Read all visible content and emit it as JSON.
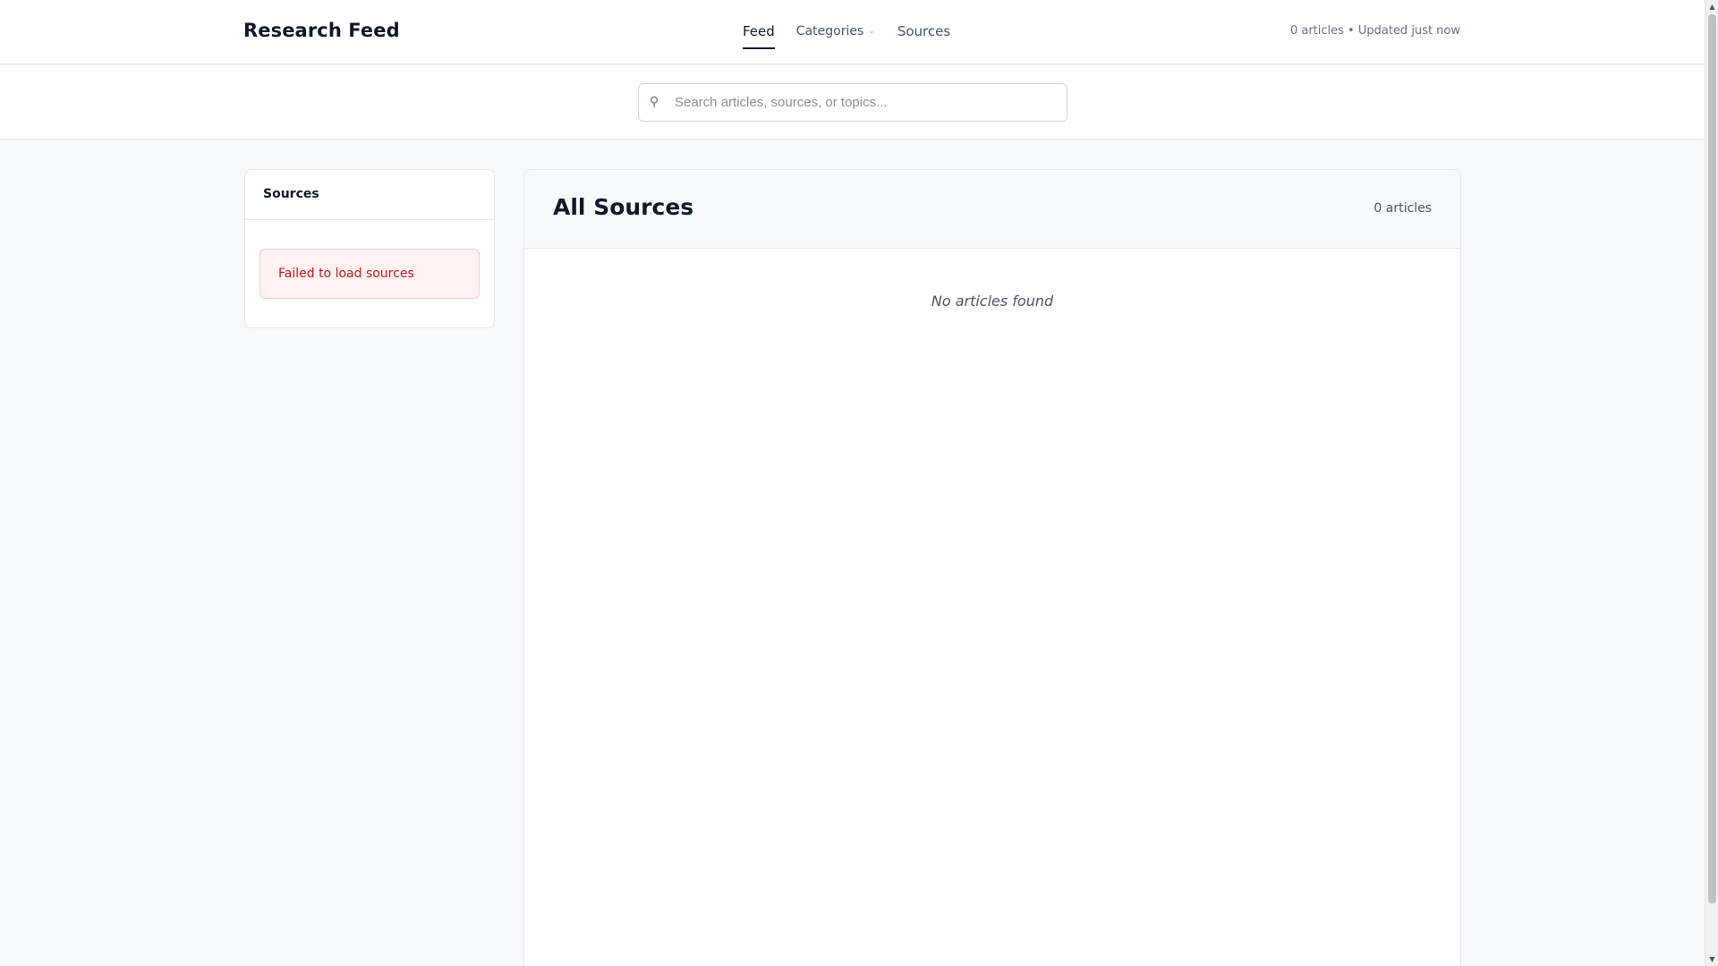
{
  "header": {
    "brand": "Research Feed",
    "nav": {
      "feed": "Feed",
      "categories": "Categories",
      "sources": "Sources"
    },
    "status": "0 articles • Updated just now"
  },
  "search": {
    "placeholder": "Search articles, sources, or topics...",
    "value": ""
  },
  "sidebar": {
    "title": "Sources",
    "error": "Failed to load sources"
  },
  "main": {
    "title": "All Sources",
    "count": "0 articles",
    "empty": "No articles found"
  },
  "colors": {
    "accent": "#111827",
    "error_text": "#b91c1c",
    "error_bg": "#fef2f2"
  },
  "icons": {
    "search": "search-icon",
    "categories_chevron": "chevron-down-icon"
  }
}
